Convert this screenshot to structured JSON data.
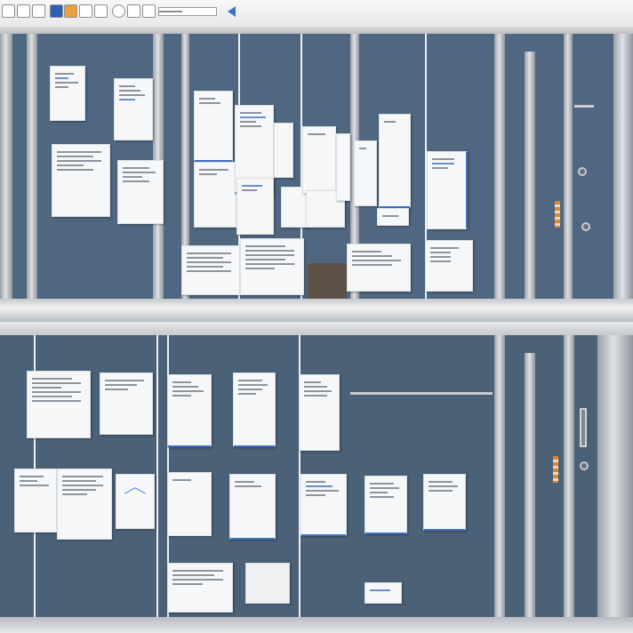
{
  "toolbar": {
    "icons": [
      "format-icon",
      "pages-icon",
      "columns-icon",
      "layout-icon",
      "color-icon",
      "share-icon",
      "transform-icon",
      "contrast-icon",
      "image-icon",
      "crop-icon"
    ],
    "zoom_level": 0.4,
    "accent": "#3b74c9"
  },
  "colors": {
    "wall_top": "#4f6780",
    "wall_bottom": "#4b6178",
    "frame": "#c8ccd1",
    "note": "#f6f7f8",
    "note_accent": "#3f6fbf",
    "tag": "#d9882f"
  }
}
